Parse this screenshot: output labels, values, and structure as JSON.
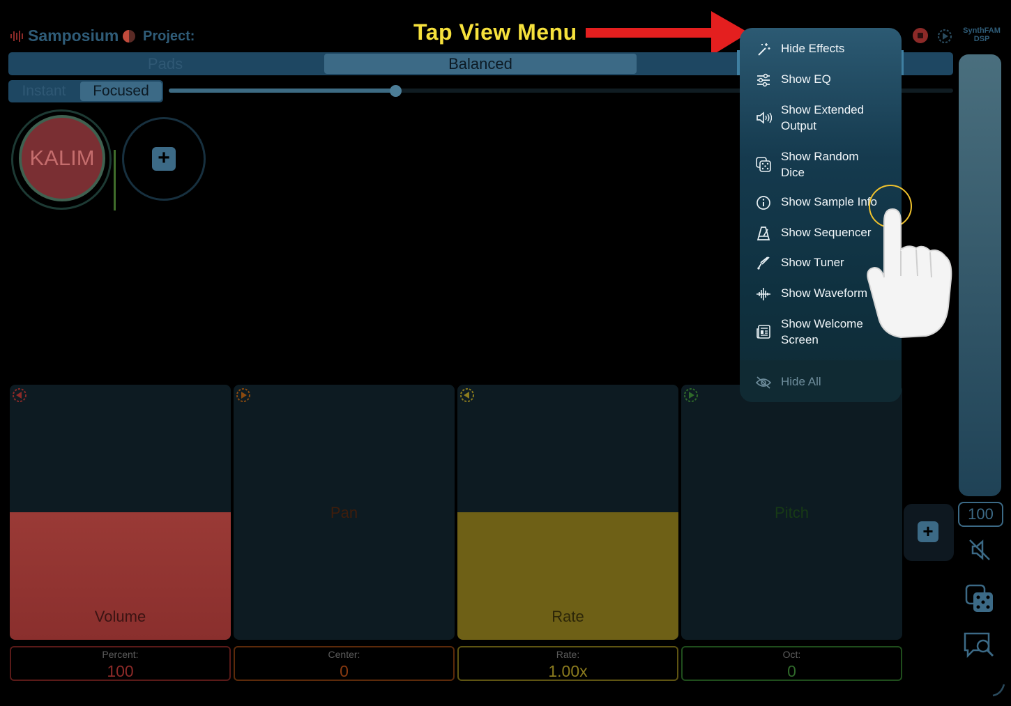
{
  "header": {
    "app_title": "Samposium",
    "project_label": "Project:",
    "brand_line1": "SynthFAM",
    "brand_line2": "DSP"
  },
  "callout": {
    "text": "Tap View Menu",
    "color": "#f6e13c",
    "arrow_color": "#e41f1f"
  },
  "tabs": [
    {
      "label": "Pads",
      "active": false
    },
    {
      "label": "Balanced",
      "active": true
    },
    {
      "label": "",
      "active": false
    }
  ],
  "mode_toggle": {
    "options": [
      "Instant",
      "Focused"
    ],
    "selected": "Focused"
  },
  "pads": [
    {
      "label": "KALIM",
      "color": "#7a2f33"
    },
    {
      "label": "+",
      "type": "add"
    }
  ],
  "faders": [
    {
      "label": "Volume",
      "caption": "Percent:",
      "value": "100",
      "color": "#b23a34",
      "level": 0.5
    },
    {
      "label": "Pan",
      "caption": "Center:",
      "value": "0",
      "color": "#c94a12",
      "level": 0.0
    },
    {
      "label": "Rate",
      "caption": "Rate:",
      "value": "1.00x",
      "color": "#e8c92d",
      "level": 0.5
    },
    {
      "label": "Pitch",
      "caption": "Oct:",
      "value": "0",
      "color": "#3f8a34",
      "level": 0.0
    }
  ],
  "master": {
    "value": "100"
  },
  "view_menu": {
    "items": [
      {
        "icon": "magic-wand-icon",
        "label": "Hide Effects"
      },
      {
        "icon": "sliders-icon",
        "label": "Show EQ"
      },
      {
        "icon": "speaker-icon",
        "label": "Show Extended\nOutput"
      },
      {
        "icon": "dice-icon",
        "label": "Show Random\nDice"
      },
      {
        "icon": "info-icon",
        "label": "Show Sample Info"
      },
      {
        "icon": "metronome-icon",
        "label": "Show Sequencer"
      },
      {
        "icon": "tuning-fork-icon",
        "label": "Show Tuner"
      },
      {
        "icon": "waveform-icon",
        "label": "Show Waveform"
      },
      {
        "icon": "newspaper-icon",
        "label": "Show Welcome\nScreen"
      },
      {
        "icon": "eye-slash-icon",
        "label": "Hide All"
      }
    ]
  }
}
